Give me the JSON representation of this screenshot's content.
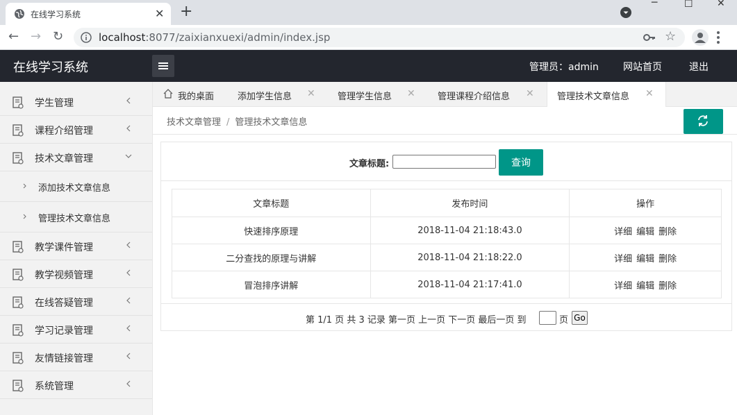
{
  "browser": {
    "tab_title": "在线学习系统",
    "url_host": "localhost",
    "url_rest": ":8077/zaixianxuexi/admin/index.jsp"
  },
  "header": {
    "logo": "在线学习系统",
    "admin_label": "管理员：admin",
    "home_link": "网站首页",
    "logout": "退出"
  },
  "sidebar": {
    "items": [
      {
        "label": "学生管理"
      },
      {
        "label": "课程介绍管理"
      },
      {
        "label": "技术文章管理"
      },
      {
        "label": "添加技术文章信息"
      },
      {
        "label": "管理技术文章信息"
      },
      {
        "label": "教学课件管理"
      },
      {
        "label": "教学视频管理"
      },
      {
        "label": "在线答疑管理"
      },
      {
        "label": "学习记录管理"
      },
      {
        "label": "友情链接管理"
      },
      {
        "label": "系统管理"
      }
    ]
  },
  "tabs": [
    {
      "label": "我的桌面"
    },
    {
      "label": "添加学生信息"
    },
    {
      "label": "管理学生信息"
    },
    {
      "label": "管理课程介绍信息"
    },
    {
      "label": "管理技术文章信息"
    }
  ],
  "breadcrumb": {
    "parent": "技术文章管理",
    "separator": "/",
    "current": "管理技术文章信息"
  },
  "search": {
    "label": "文章标题:",
    "value": "",
    "button": "查询"
  },
  "table": {
    "headers": [
      "文章标题",
      "发布时间",
      "操作"
    ],
    "rows": [
      {
        "title": "快速排序原理",
        "time": "2018-11-04 21:18:43.0"
      },
      {
        "title": "二分查找的原理与讲解",
        "time": "2018-11-04 21:18:22.0"
      },
      {
        "title": "冒泡排序讲解",
        "time": "2018-11-04 21:17:41.0"
      }
    ],
    "actions": {
      "detail": "详细",
      "edit": "编辑",
      "delete": "删除"
    }
  },
  "pager": {
    "text": "第 1/1 页 共 3 记录 第一页 上一页 下一页 最后一页 到",
    "page_unit": "页",
    "go": "Go"
  },
  "colors": {
    "accent": "#009688",
    "header_bg": "#23262e",
    "sidebar_bg": "#f2f2f2"
  }
}
